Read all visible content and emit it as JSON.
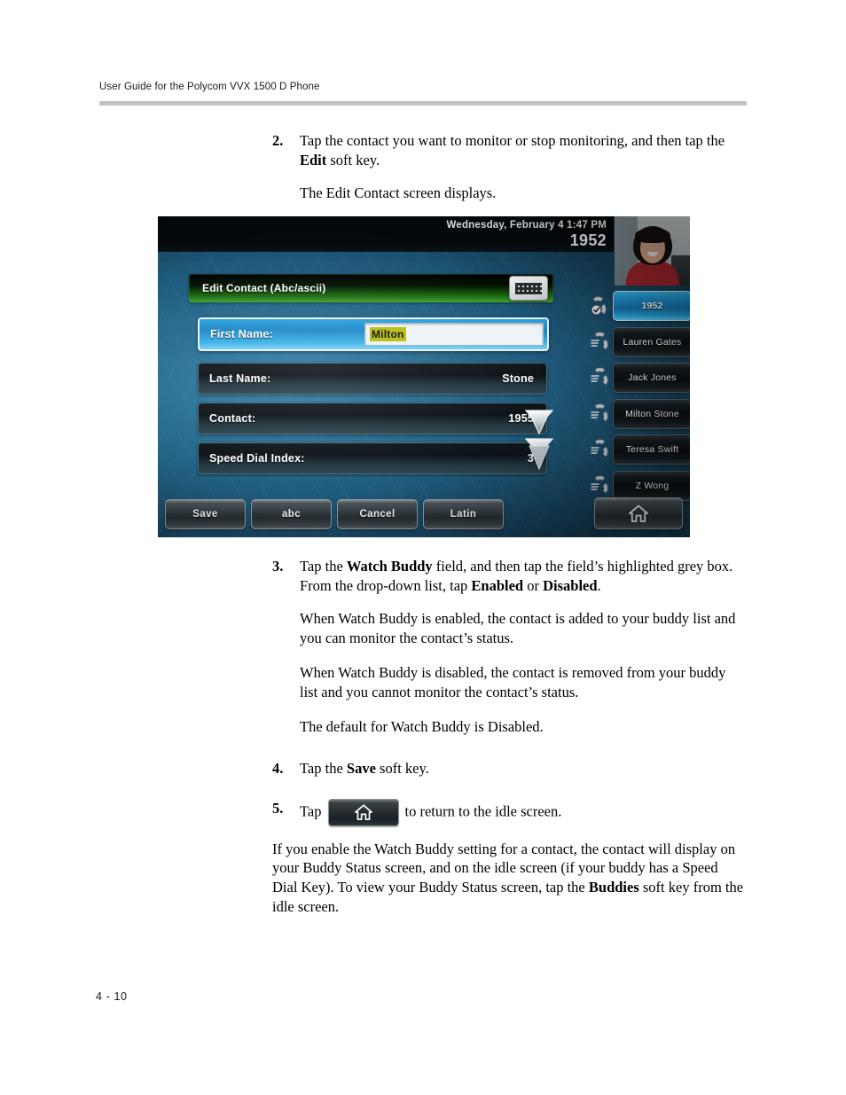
{
  "page": {
    "running_header": "User Guide for the Polycom VVX 1500 D Phone",
    "footer_page_number": "4 - 10"
  },
  "steps": [
    {
      "number": "2.",
      "text_before_bold": "Tap the contact you want to monitor or stop monitoring, and then tap the ",
      "bold": "Edit",
      "text_after_bold": " soft key.",
      "follow_up": "The Edit Contact screen displays."
    },
    {
      "number": "3.",
      "seg1": "Tap the ",
      "bold1": "Watch Buddy",
      "seg2": " field, and then tap the field’s highlighted grey box. From the drop-down list, tap ",
      "bold2": "Enabled",
      "seg3": " or ",
      "bold3": "Disabled",
      "seg4": ".",
      "para1": "When Watch Buddy is enabled, the contact is added to your buddy list and you can monitor the contact’s status.",
      "para2": "When Watch Buddy is disabled, the contact is removed from your buddy list and you cannot monitor the contact’s status.",
      "para3": "The default for Watch Buddy is Disabled."
    },
    {
      "number": "4.",
      "seg1": "Tap the ",
      "bold1": "Save",
      "seg2": " soft key."
    },
    {
      "number": "5.",
      "seg1": "Tap",
      "seg2": "to return to the idle screen.",
      "icon": "home-icon"
    }
  ],
  "closing_paragraph": {
    "seg1": "If you enable the Watch Buddy setting for a contact, the contact will display on your Buddy Status screen, and on the idle screen (if your buddy has a Speed Dial Key). To view your Buddy Status screen, tap the ",
    "bold1": "Buddies",
    "seg2": " soft key from the idle screen."
  },
  "phone_screen": {
    "status_bar": {
      "date_time": "Wednesday, February 4  1:47 PM",
      "extension": "1952"
    },
    "video_thumbnail": "self-view-video",
    "window_title": "Edit Contact (Abc/ascii)",
    "keyboard_icon": "keyboard-icon",
    "fields": [
      {
        "label": "First Name:",
        "value": "Milton",
        "selected": true,
        "editing": true
      },
      {
        "label": "Last Name:",
        "value": "Stone",
        "selected": false,
        "editing": false
      },
      {
        "label": "Contact:",
        "value": "1955",
        "selected": false,
        "editing": false
      },
      {
        "label": "Speed Dial Index:",
        "value": "3",
        "selected": false,
        "editing": false
      }
    ],
    "scroll_indicator": "scroll-down-arrows",
    "buddy_list": [
      {
        "label": "1952",
        "active": true
      },
      {
        "label": "Lauren Gates",
        "active": false
      },
      {
        "label": "Jack Jones",
        "active": false
      },
      {
        "label": "Milton Stone",
        "active": false
      },
      {
        "label": "Teresa Swift",
        "active": false
      },
      {
        "label": "Z Wong",
        "active": false
      }
    ],
    "soft_keys": [
      "Save",
      "abc",
      "Cancel",
      "Latin"
    ],
    "home_key": "home-icon",
    "colors": {
      "background_blue": "#1f5d80",
      "title_green": "#3da32a",
      "selected_field_blue": "#2aa4e0",
      "edit_highlight_olive": "#b8bc12",
      "status_bar_black": "#05090c"
    }
  }
}
